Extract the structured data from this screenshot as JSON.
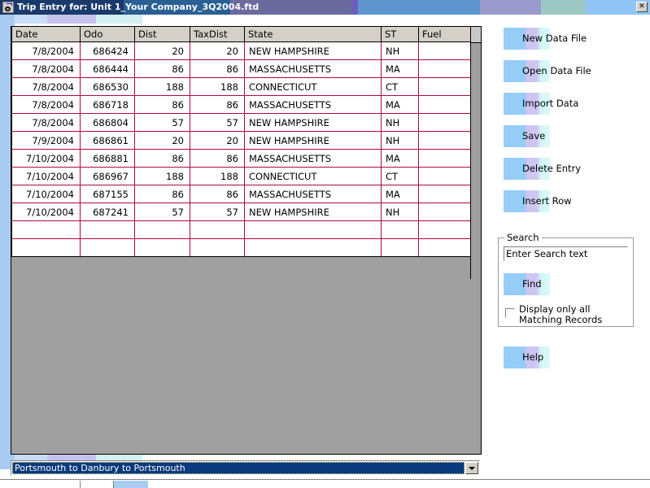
{
  "window": {
    "title": "Trip Entry for: Unit 1_Your Company_3Q2004.ftd",
    "icon": "odometer-icon",
    "close_label": "✕"
  },
  "grid": {
    "columns": [
      "Date",
      "Odo",
      "Dist",
      "TaxDist",
      "State",
      "ST",
      "Fuel"
    ],
    "rows": [
      {
        "date": "7/8/2004",
        "odo": "686424",
        "dist": "20",
        "taxdist": "20",
        "state": "NEW HAMPSHIRE",
        "st": "NH",
        "fuel": ""
      },
      {
        "date": "7/8/2004",
        "odo": "686444",
        "dist": "86",
        "taxdist": "86",
        "state": "MASSACHUSETTS",
        "st": "MA",
        "fuel": ""
      },
      {
        "date": "7/8/2004",
        "odo": "686530",
        "dist": "188",
        "taxdist": "188",
        "state": "CONNECTICUT",
        "st": "CT",
        "fuel": ""
      },
      {
        "date": "7/8/2004",
        "odo": "686718",
        "dist": "86",
        "taxdist": "86",
        "state": "MASSACHUSETTS",
        "st": "MA",
        "fuel": ""
      },
      {
        "date": "7/8/2004",
        "odo": "686804",
        "dist": "57",
        "taxdist": "57",
        "state": "NEW HAMPSHIRE",
        "st": "NH",
        "fuel": ""
      },
      {
        "date": "7/9/2004",
        "odo": "686861",
        "dist": "20",
        "taxdist": "20",
        "state": "NEW HAMPSHIRE",
        "st": "NH",
        "fuel": ""
      },
      {
        "date": "7/10/2004",
        "odo": "686881",
        "dist": "86",
        "taxdist": "86",
        "state": "MASSACHUSETTS",
        "st": "MA",
        "fuel": ""
      },
      {
        "date": "7/10/2004",
        "odo": "686967",
        "dist": "188",
        "taxdist": "188",
        "state": "CONNECTICUT",
        "st": "CT",
        "fuel": ""
      },
      {
        "date": "7/10/2004",
        "odo": "687155",
        "dist": "86",
        "taxdist": "86",
        "state": "MASSACHUSETTS",
        "st": "MA",
        "fuel": ""
      },
      {
        "date": "7/10/2004",
        "odo": "687241",
        "dist": "57",
        "taxdist": "57",
        "state": "NEW HAMPSHIRE",
        "st": "NH",
        "fuel": ""
      },
      {
        "date": "",
        "odo": "",
        "dist": "",
        "taxdist": "",
        "state": "",
        "st": "",
        "fuel": ""
      },
      {
        "date": "",
        "odo": "",
        "dist": "",
        "taxdist": "",
        "state": "",
        "st": "",
        "fuel": ""
      }
    ]
  },
  "actions": [
    {
      "label": "New Data File",
      "name": "new-data-file"
    },
    {
      "label": "Open Data File",
      "name": "open-data-file"
    },
    {
      "label": "Import Data",
      "name": "import-data"
    },
    {
      "label": "Save",
      "name": "save"
    },
    {
      "label": "Delete Entry",
      "name": "delete-entry"
    },
    {
      "label": "Insert Row",
      "name": "insert-row"
    }
  ],
  "search": {
    "legend": "Search",
    "input_value": "Enter Search text",
    "input_placeholder": "Enter Search text",
    "find_label": "Find",
    "checkbox_label": "Display only all Matching Records",
    "checkbox_checked": false
  },
  "help": {
    "label": "Help"
  },
  "combo": {
    "selected": "Portsmouth to Danbury to Portsmouth"
  },
  "colors": {
    "grid_line": "#b0083c",
    "header_bg": "#d4d0c8",
    "panel_bg": "#a0a0a0",
    "titlebar_start": "#1a3a6b",
    "button_gradient_start": "#96cdf7",
    "button_gradient_mid": "#cdc6f2",
    "button_gradient_end": "#d8fafa",
    "combo_highlight": "#0a3a7d"
  }
}
